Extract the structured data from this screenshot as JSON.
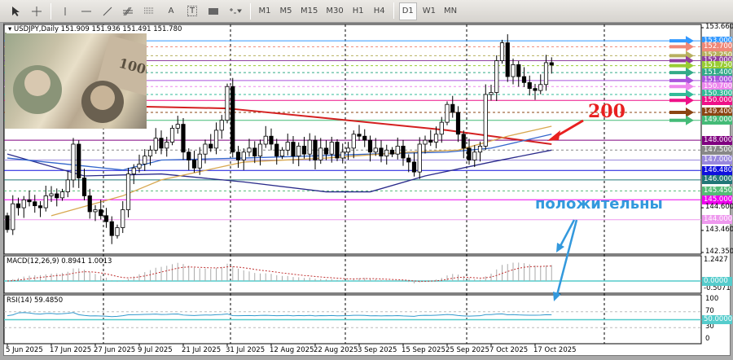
{
  "toolbar": {
    "tools": [
      "cursor-icon",
      "crosshair-icon",
      "vertical-line-icon",
      "horizontal-line-icon",
      "trendline-icon",
      "fibonacci-icon",
      "fibo-channel-icon",
      "text-icon",
      "text-label-icon",
      "rectangle-icon",
      "shapes-dropdown-icon"
    ],
    "text_tool": "A",
    "label_tool": "T",
    "timeframes": [
      "M1",
      "M5",
      "M15",
      "M30",
      "H1",
      "H4",
      "D1",
      "W1",
      "MN"
    ],
    "active_timeframe": "D1"
  },
  "chart_data": {
    "type": "candlestick",
    "title": "USDJPY,Daily  151.909 151.936 151.491 151.780",
    "symbol": "USDJPY",
    "period": "Daily",
    "ylim": [
      142.35,
      153.66
    ],
    "price_ticks": [
      "153.660",
      "144.600",
      "143.460",
      "142.350"
    ],
    "date_labels": [
      "5 Jun 2025",
      "17 Jun 2025",
      "27 Jun 2025",
      "9 Jul 2025",
      "21 Jul 2025",
      "31 Jul 2025",
      "12 Aug 2025",
      "22 Aug 2025",
      "3 Sep 2025",
      "15 Sep 2025",
      "25 Sep 2025",
      "7 Oct 2025",
      "17 Oct 2025"
    ],
    "date_label_bar_step": 8,
    "closes": [
      143.5,
      144.8,
      144.6,
      145.0,
      144.9,
      144.7,
      144.6,
      145.2,
      145.3,
      145.1,
      145.4,
      146.0,
      147.8,
      146.1,
      145.2,
      144.4,
      144.5,
      144.2,
      143.9,
      143.2,
      143.6,
      144.5,
      146.3,
      146.6,
      146.8,
      147.2,
      147.5,
      148.1,
      147.6,
      147.9,
      148.6,
      148.8,
      147.4,
      147.0,
      146.6,
      147.3,
      147.8,
      147.6,
      148.5,
      149.0,
      150.7,
      147.4,
      147.0,
      147.4,
      147.6,
      147.2,
      147.8,
      148.2,
      147.8,
      147.2,
      147.5,
      147.9,
      147.2,
      147.7,
      147.3,
      148.0,
      147.0,
      147.6,
      147.3,
      147.9,
      147.1,
      147.4,
      147.6,
      148.3,
      148.2,
      148.0,
      147.4,
      147.6,
      147.2,
      147.5,
      147.3,
      147.7,
      147.1,
      146.9,
      146.4,
      147.8,
      148.0,
      147.9,
      148.3,
      148.9,
      149.8,
      149.4,
      148.3,
      147.6,
      147.0,
      147.4,
      147.7,
      150.3,
      150.4,
      152.0,
      152.9,
      151.2,
      151.8,
      151.2,
      150.9,
      150.6,
      150.5,
      150.8,
      151.9,
      151.78
    ],
    "first_open": 144.2,
    "moving_averages": [
      {
        "name": "MA200",
        "color": "#d42020",
        "points": [
          [
            0,
            149.8
          ],
          [
            14,
            149.75
          ],
          [
            40,
            149.6
          ],
          [
            62,
            149.0
          ],
          [
            80,
            148.5
          ],
          [
            99,
            147.8
          ]
        ]
      },
      {
        "name": "MA-slow",
        "color": "#2a2a8a",
        "points": [
          [
            0,
            147.3
          ],
          [
            14,
            146.2
          ],
          [
            28,
            146.3
          ],
          [
            43,
            145.9
          ],
          [
            58,
            145.4
          ],
          [
            66,
            145.4
          ],
          [
            76,
            146.2
          ],
          [
            88,
            146.9
          ],
          [
            99,
            147.5
          ]
        ]
      },
      {
        "name": "MA-mid",
        "color": "#3366cc",
        "points": [
          [
            0,
            147.1
          ],
          [
            14,
            146.7
          ],
          [
            21,
            146.5
          ],
          [
            28,
            147.0
          ],
          [
            43,
            147.1
          ],
          [
            66,
            147.3
          ],
          [
            80,
            147.4
          ],
          [
            88,
            147.6
          ],
          [
            99,
            148.3
          ]
        ]
      },
      {
        "name": "MA-fast",
        "color": "#d8a850",
        "points": [
          [
            8,
            144.2
          ],
          [
            21,
            145.2
          ],
          [
            28,
            146.0
          ],
          [
            43,
            146.9
          ],
          [
            58,
            147.1
          ],
          [
            73,
            147.4
          ],
          [
            82,
            147.5
          ],
          [
            91,
            148.2
          ],
          [
            99,
            148.7
          ]
        ]
      }
    ],
    "levels": [
      {
        "price": "153.000",
        "color": "#3399ff",
        "style": "solid"
      },
      {
        "price": "152.700",
        "color": "#f08878",
        "style": "dashed"
      },
      {
        "price": "152.250",
        "color": "#b8b060",
        "style": "dashed"
      },
      {
        "price": "152.000",
        "color": "#9040a0",
        "style": "solid"
      },
      {
        "price": "151.750",
        "color": "#99cc33",
        "style": "dashed"
      },
      {
        "price": "151.400",
        "color": "#33aa88",
        "style": "dashed"
      },
      {
        "price": "151.000",
        "color": "#aa55dd",
        "style": "solid"
      },
      {
        "price": "150.700",
        "color": "#ee88ee",
        "style": "dashed"
      },
      {
        "price": "150.300",
        "color": "#33bb99",
        "style": "dashed"
      },
      {
        "price": "150.000",
        "color": "#ee1188",
        "style": "solid"
      },
      {
        "price": "149.400",
        "color": "#8b4513",
        "style": "dashed"
      },
      {
        "price": "149.000",
        "color": "#44bb77",
        "style": "solid"
      },
      {
        "price": "148.000",
        "color": "#800080",
        "style": "solid"
      },
      {
        "price": "147.500",
        "color": "#888888",
        "style": "dashed"
      },
      {
        "price": "147.000",
        "color": "#9988dd",
        "style": "solid"
      },
      {
        "price": "146.480",
        "color": "#1010dd",
        "style": "solid"
      },
      {
        "price": "146.000",
        "color": "#227777",
        "style": "solid"
      },
      {
        "price": "145.450",
        "color": "#55bb77",
        "style": "dashed"
      },
      {
        "price": "145.000",
        "color": "#ee00ee",
        "style": "solid"
      },
      {
        "price": "144.000",
        "color": "#ee99ee",
        "style": "solid"
      }
    ],
    "macd": {
      "label": "MACD(12,26,9) 0.8941 1.0013",
      "axis_max": "1.2427",
      "axis_min": "-0.5071",
      "zero": "0.0000",
      "range": [
        -0.5071,
        1.2427
      ]
    },
    "rsi": {
      "label": "RSI(14) 59.4850",
      "ticks": [
        "100",
        "70",
        "30",
        "0"
      ],
      "mid": "50.0000"
    }
  },
  "annotations": {
    "ma_label": "200",
    "comment": "положительны",
    "ma_arrow_color": "#e82020",
    "comment_color": "#3399dd"
  }
}
